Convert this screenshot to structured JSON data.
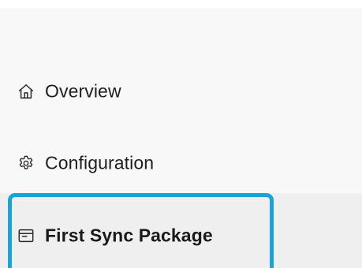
{
  "nav": {
    "items": [
      {
        "label": "Overview",
        "icon": "home-icon"
      },
      {
        "label": "Configuration",
        "icon": "gear-icon"
      },
      {
        "label": "First Sync Package",
        "icon": "package-icon",
        "selected": true
      }
    ]
  },
  "colors": {
    "accent": "#1aa3d9",
    "background": "#f8f8f8",
    "selected_bg": "#efefef",
    "text": "#1f1f1f"
  }
}
